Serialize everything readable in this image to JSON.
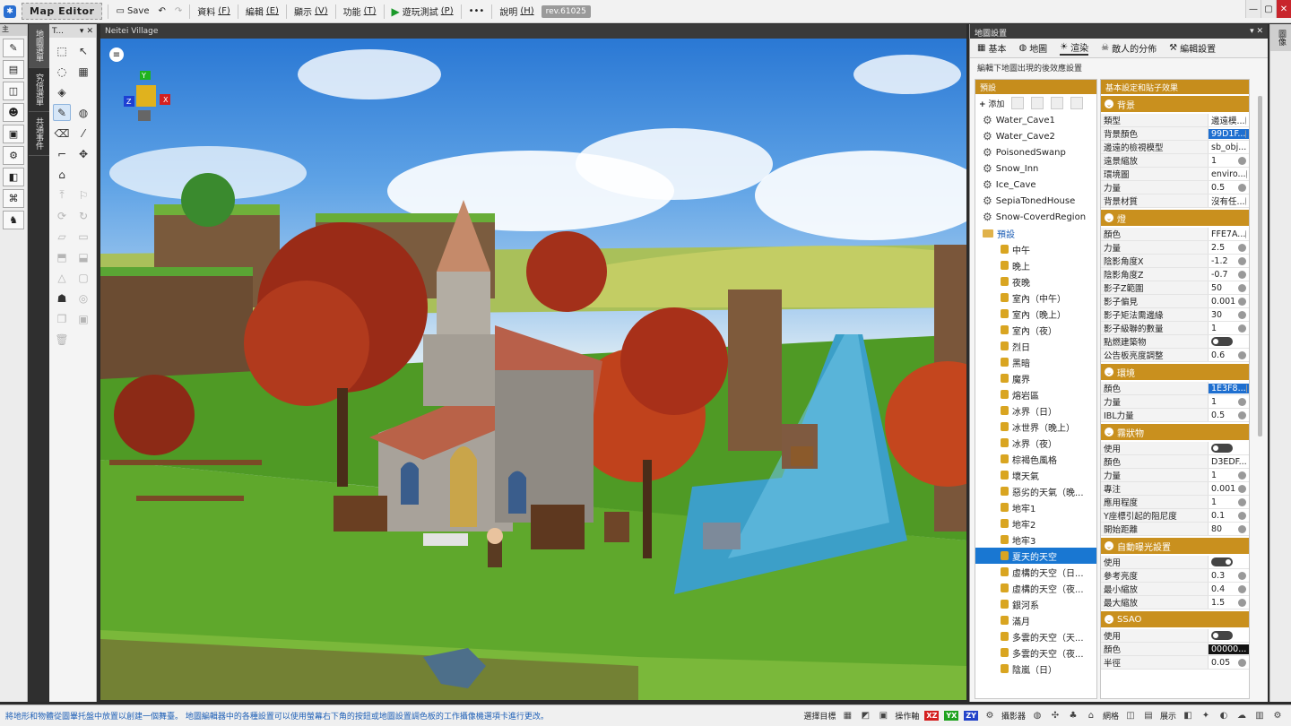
{
  "app": {
    "title": "Map Editor",
    "save_label": "Save",
    "rev": "rev.61025"
  },
  "menu": [
    {
      "label": "資料",
      "key": "(F)"
    },
    {
      "label": "編輯",
      "key": "(E)"
    },
    {
      "label": "顯示",
      "key": "(V)"
    },
    {
      "label": "功能",
      "key": "(T)"
    },
    {
      "label": "遊玩測試",
      "key": "(P)"
    },
    {
      "label": "說明",
      "key": "(H)"
    }
  ],
  "left_strip_header": "主",
  "vertical_tabs": [
    "地圖選單",
    "究倍選單",
    "共通事件"
  ],
  "tool_panel_title": "T...",
  "viewport": {
    "title": "Neitei Village"
  },
  "right_panel": {
    "title": "地圖設置",
    "tabs": [
      "基本",
      "地圖",
      "渲染",
      "敵人的分佈",
      "編輯設置"
    ],
    "description": "編輯下地圖出現的後效應設置",
    "presets_header": "預設",
    "props_header": "基本設定和貼子效果",
    "add_label": "添加",
    "presets": [
      {
        "label": "Water_Cave1",
        "kind": "gear"
      },
      {
        "label": "Water_Cave2",
        "kind": "gear"
      },
      {
        "label": "PoisonedSwanp",
        "kind": "gear"
      },
      {
        "label": "Snow_Inn",
        "kind": "gear"
      },
      {
        "label": "Ice_Cave",
        "kind": "gear"
      },
      {
        "label": "SepiaTonedHouse",
        "kind": "gear"
      },
      {
        "label": "Snow-CoverdRegion",
        "kind": "gear"
      },
      {
        "label": "預設",
        "kind": "folder"
      },
      {
        "label": "中午",
        "kind": "lock"
      },
      {
        "label": "晚上",
        "kind": "lock"
      },
      {
        "label": "夜晚",
        "kind": "lock"
      },
      {
        "label": "室內（中午）",
        "kind": "lock"
      },
      {
        "label": "室內（晚上）",
        "kind": "lock"
      },
      {
        "label": "室內（夜）",
        "kind": "lock"
      },
      {
        "label": "烈日",
        "kind": "lock"
      },
      {
        "label": "黑暗",
        "kind": "lock"
      },
      {
        "label": "魔界",
        "kind": "lock"
      },
      {
        "label": "熔岩區",
        "kind": "lock"
      },
      {
        "label": "冰界（日）",
        "kind": "lock"
      },
      {
        "label": "冰世界（晚上）",
        "kind": "lock"
      },
      {
        "label": "冰界（夜）",
        "kind": "lock"
      },
      {
        "label": "棕褐色風格",
        "kind": "lock"
      },
      {
        "label": "壞天氣",
        "kind": "lock"
      },
      {
        "label": "惡劣的天氣（晚...",
        "kind": "lock"
      },
      {
        "label": "地牢1",
        "kind": "lock"
      },
      {
        "label": "地牢2",
        "kind": "lock"
      },
      {
        "label": "地牢3",
        "kind": "lock"
      },
      {
        "label": "夏天的天空",
        "kind": "lock",
        "selected": true
      },
      {
        "label": "虛構的天空（日...",
        "kind": "lock"
      },
      {
        "label": "虛構的天空（夜...",
        "kind": "lock"
      },
      {
        "label": "銀河系",
        "kind": "lock"
      },
      {
        "label": "滿月",
        "kind": "lock"
      },
      {
        "label": "多雲的天空（天...",
        "kind": "lock"
      },
      {
        "label": "多雲的天空（夜...",
        "kind": "lock"
      },
      {
        "label": "陰嵐（日）",
        "kind": "lock"
      }
    ],
    "sections": [
      {
        "title": "背景",
        "rows": [
          {
            "label": "類型",
            "value": "邊遠模..."
          },
          {
            "label": "背景顏色",
            "value": "99D1F...",
            "style": "hl"
          },
          {
            "label": "邊遠的檢視模型",
            "value": "sb_obj..."
          },
          {
            "label": "遠景縮放",
            "value": "1"
          },
          {
            "label": "環境圖",
            "value": "enviro..."
          },
          {
            "label": "力量",
            "value": "0.5"
          },
          {
            "label": "背景材質",
            "value": "沒有任..."
          }
        ]
      },
      {
        "title": "燈",
        "rows": [
          {
            "label": "顏色",
            "value": "FFE7A..."
          },
          {
            "label": "力量",
            "value": "2.5"
          },
          {
            "label": "陰影角度X",
            "value": "-1.2"
          },
          {
            "label": "陰影角度Z",
            "value": "-0.7"
          },
          {
            "label": "影子Z範圍",
            "value": "50"
          },
          {
            "label": "影子偏見",
            "value": "0.001"
          },
          {
            "label": "影子矩法需邊緣",
            "value": "30"
          },
          {
            "label": "影子級聯的數量",
            "value": "1"
          },
          {
            "label": "點燃建築物",
            "value": "",
            "toggle": "off"
          },
          {
            "label": "公告板亮度調整",
            "value": "0.6"
          }
        ]
      },
      {
        "title": "環境",
        "rows": [
          {
            "label": "顏色",
            "value": "1E3F8...",
            "style": "hl"
          },
          {
            "label": "力量",
            "value": "1"
          },
          {
            "label": "IBL力量",
            "value": "0.5"
          }
        ]
      },
      {
        "title": "霧狀物",
        "rows": [
          {
            "label": "使用",
            "value": "",
            "toggle": "off"
          },
          {
            "label": "顏色",
            "value": "D3EDF..."
          },
          {
            "label": "力量",
            "value": "1"
          },
          {
            "label": "專注",
            "value": "0.001"
          },
          {
            "label": "應用程度",
            "value": "1"
          },
          {
            "label": "Y座標引起的阻尼度",
            "value": "0.1"
          },
          {
            "label": "開始距離",
            "value": "80"
          }
        ]
      },
      {
        "title": "自動曝光設置",
        "rows": [
          {
            "label": "使用",
            "value": "",
            "toggle": "on"
          },
          {
            "label": "參考亮度",
            "value": "0.3"
          },
          {
            "label": "最小縮放",
            "value": "0.4"
          },
          {
            "label": "最大縮放",
            "value": "1.5"
          }
        ]
      },
      {
        "title": "SSAO",
        "rows": [
          {
            "label": "使用",
            "value": "",
            "toggle": "off"
          },
          {
            "label": "顏色",
            "value": "00000...",
            "style": "dk"
          },
          {
            "label": "半徑",
            "value": "0.05"
          }
        ]
      }
    ]
  },
  "right_side_tab": "圖像",
  "status": {
    "message": "將地形和物體從圖畢托盤中放置以創建一個舞臺。  地圖編輯器中的各種設置可以使用螢幕右下角的按鈕或地圖設置調色板的工作攝像機選項卡進行更改。",
    "select_label": "選擇目標",
    "operate_label": "操作軸",
    "camera_label": "攝影器",
    "grid_label": "網格",
    "display_label": "展示",
    "axes": [
      "XZ",
      "YX",
      "ZY"
    ]
  },
  "colors": {
    "accent_gold": "#c68d1c",
    "selection_blue": "#1977d2"
  }
}
